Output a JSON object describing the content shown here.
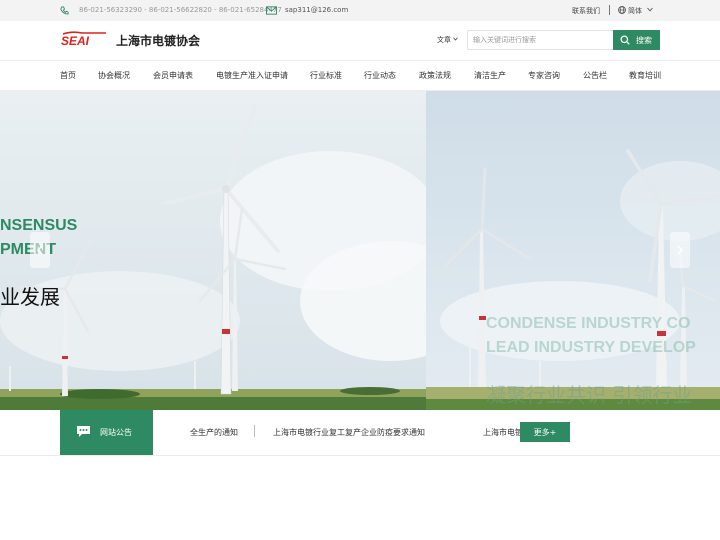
{
  "topbar": {
    "phones": "86-021-56323290 - 86-021-56622820 - 86-021-65284477",
    "email": "sap311@126.com",
    "contact": "联系我们",
    "language": "简体"
  },
  "header": {
    "logo_text": "SEAI",
    "title": "上海市电镀协会",
    "search_scope": "文章",
    "search_placeholder": "输入关键词进行搜索",
    "search_button": "搜索"
  },
  "nav": {
    "items": [
      "首页",
      "协会概况",
      "会员申请表",
      "电镀生产准入证申请",
      "行业标准",
      "行业动态",
      "政策法规",
      "清洁生产",
      "专家咨询",
      "公告栏",
      "教育培训"
    ]
  },
  "banner": {
    "slide1_en_line1": "NSENSUS",
    "slide1_en_line2": "PMENT",
    "slide1_cn": "业发展",
    "slide2_en_line1": "CONDENSE INDUSTRY CO",
    "slide2_en_line2": "LEAD INDUSTRY DEVELOP",
    "slide2_cn": "凝聚行业共识 引领行业"
  },
  "notice": {
    "label": "网站公告",
    "items": [
      "全生产的通知",
      "上海市电镀行业复工复产企业防疫要求通知",
      "上海市电镀"
    ],
    "more": "更多+"
  },
  "colors": {
    "brand_green": "#2e8a63",
    "logo_red": "#d9251c"
  }
}
